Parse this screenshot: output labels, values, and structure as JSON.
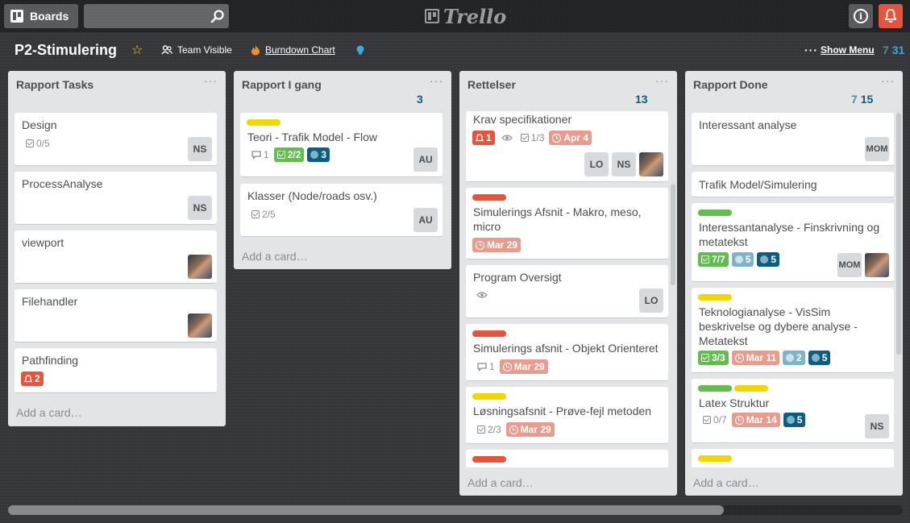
{
  "header": {
    "boards_label": "Boards",
    "logo_text": "Trello",
    "search_placeholder": ""
  },
  "board": {
    "title": "P2-Stimulering",
    "visibility": "Team Visible",
    "burndown": "Burndown Chart",
    "menu_label": "Show Menu",
    "points_a": "7",
    "points_b": "31"
  },
  "colors": {
    "red": "#e5543d",
    "green": "#61bd4f",
    "yellow": "#f2d600",
    "blue": "#0d5d80",
    "points_teal": "#4d8ea6",
    "points_blue": "#3fa9d8"
  },
  "lists": [
    {
      "title": "Rapport Tasks",
      "points": "",
      "add_card": "Add a card…",
      "cards": [
        {
          "title": "Design",
          "checklist": "0/5",
          "member": "NS"
        },
        {
          "title": "ProcessAnalyse",
          "member": "NS"
        },
        {
          "title": "viewport",
          "member_icon": "avatar-photo"
        },
        {
          "title": "Filehandler",
          "member_icon": "avatar-photo"
        },
        {
          "title": "Pathfinding",
          "alert": "2"
        }
      ]
    },
    {
      "title": "Rapport I gang",
      "points": "3",
      "add_card": "Add a card…",
      "cards": [
        {
          "title": "Teori - Trafik Model - Flow",
          "label": "yellow",
          "comments": "1",
          "checklist": "2/2",
          "estimate": "3",
          "member": "AU"
        },
        {
          "title": "Klasser (Node/roads osv.)",
          "checklist": "2/5",
          "member": "AU"
        }
      ]
    },
    {
      "title": "Rettelser",
      "points": "13",
      "add_card": "Add a card…",
      "cards": [
        {
          "title": "Krav specifikationer",
          "alert": "1",
          "checklist": "1/3",
          "due": "Apr 4",
          "members": [
            "LO",
            "NS"
          ]
        },
        {
          "title": "Simulerings Afsnit - Makro, meso, micro",
          "label": "red",
          "due": "Mar 29"
        },
        {
          "title": "Program Oversigt",
          "member": "LO"
        },
        {
          "title": "Simulerings afsnit - Objekt Orienteret",
          "label": "red",
          "comments": "1",
          "due": "Mar 29"
        },
        {
          "title": "Løsningsafsnit - Prøve-fejl metoden",
          "label": "yellow",
          "checklist": "2/3",
          "due": "Mar 29"
        },
        {
          "title": "",
          "label": "red"
        }
      ]
    },
    {
      "title": "Rapport Done",
      "points_a": "7",
      "points_b": "15",
      "add_card": "Add a card…",
      "cards": [
        {
          "title": "Interessant analyse",
          "member": "MOM"
        },
        {
          "title": "Trafik Model/Simulering"
        },
        {
          "title": "Interessantanalyse - Finskrivning og metatekst",
          "label": "green",
          "checklist": "7/7",
          "points": "5",
          "estimate": "5",
          "member": "MOM"
        },
        {
          "title": "Teknologianalyse - VisSim beskrivelse og dybere analyse - Metatekst",
          "label": "yellow",
          "checklist": "3/3",
          "due": "Mar 11",
          "points": "2",
          "estimate": "5"
        },
        {
          "title": "Latex Struktur",
          "labels": [
            "green",
            "yellow"
          ],
          "checklist": "0/7",
          "due": "Mar 14",
          "estimate": "5",
          "member": "NS"
        },
        {
          "title": "",
          "label": "yellow"
        }
      ]
    }
  ]
}
